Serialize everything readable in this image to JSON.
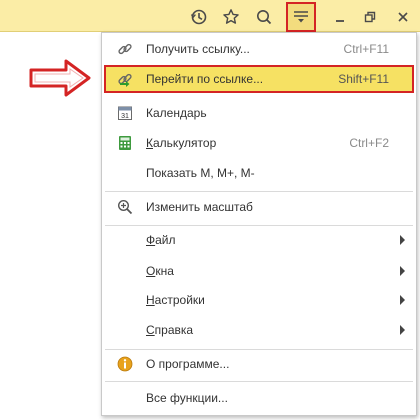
{
  "toolbar": {
    "icons": [
      "history-icon",
      "star-icon",
      "search-icon",
      "main-menu-icon",
      "minimize-icon",
      "restore-icon",
      "close-icon"
    ]
  },
  "menu": {
    "items": [
      {
        "label": "Получить ссылку...",
        "shortcut": "Ctrl+F11",
        "icon": "link-icon"
      },
      {
        "label": "Перейти по ссылке...",
        "shortcut": "Shift+F11",
        "icon": "go-to-link-icon",
        "active": true
      },
      {
        "label": "Календарь",
        "shortcut": "",
        "icon": "calendar-icon"
      },
      {
        "label": "Калькулятор",
        "shortcut": "Ctrl+F2",
        "icon": "calculator-icon"
      },
      {
        "label": "Показать M, M+, M-",
        "shortcut": ""
      },
      {
        "label": "Изменить масштаб",
        "shortcut": "",
        "icon": "zoom-icon"
      },
      {
        "label": "Файл",
        "submenu": true
      },
      {
        "label": "Окна",
        "submenu": true
      },
      {
        "label": "Настройки",
        "submenu": true
      },
      {
        "label": "Справка",
        "submenu": true
      },
      {
        "label": "О программе...",
        "icon": "info-icon"
      },
      {
        "label": "Все функции..."
      }
    ]
  },
  "colors": {
    "toolbar_bg": "#fbeda6",
    "highlight": "#f6e163",
    "annotation_red": "#d42424"
  }
}
